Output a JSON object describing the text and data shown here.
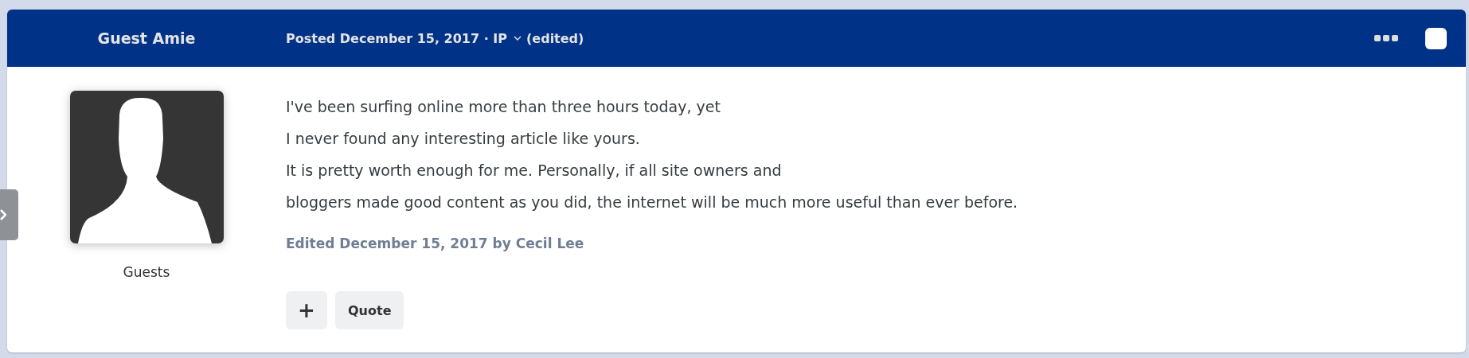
{
  "post": {
    "author": "Guest Amie",
    "meta": "Posted December 15, 2017 · IP",
    "meta_suffix": "(edited)",
    "select_checked": false,
    "author_group": "Guests",
    "lines": [
      "I've been surfing online more than three hours today, yet",
      "I never found any interesting article like yours.",
      "It is pretty worth enough for me. Personally, if all site owners and",
      "bloggers made good content as you did, the internet will be much more useful than ever before."
    ],
    "edited_note": "Edited December 15, 2017 by Cecil Lee",
    "buttons": [
      {
        "kind": "icon",
        "label": "+"
      },
      {
        "kind": "text",
        "label": "Quote"
      }
    ]
  }
}
